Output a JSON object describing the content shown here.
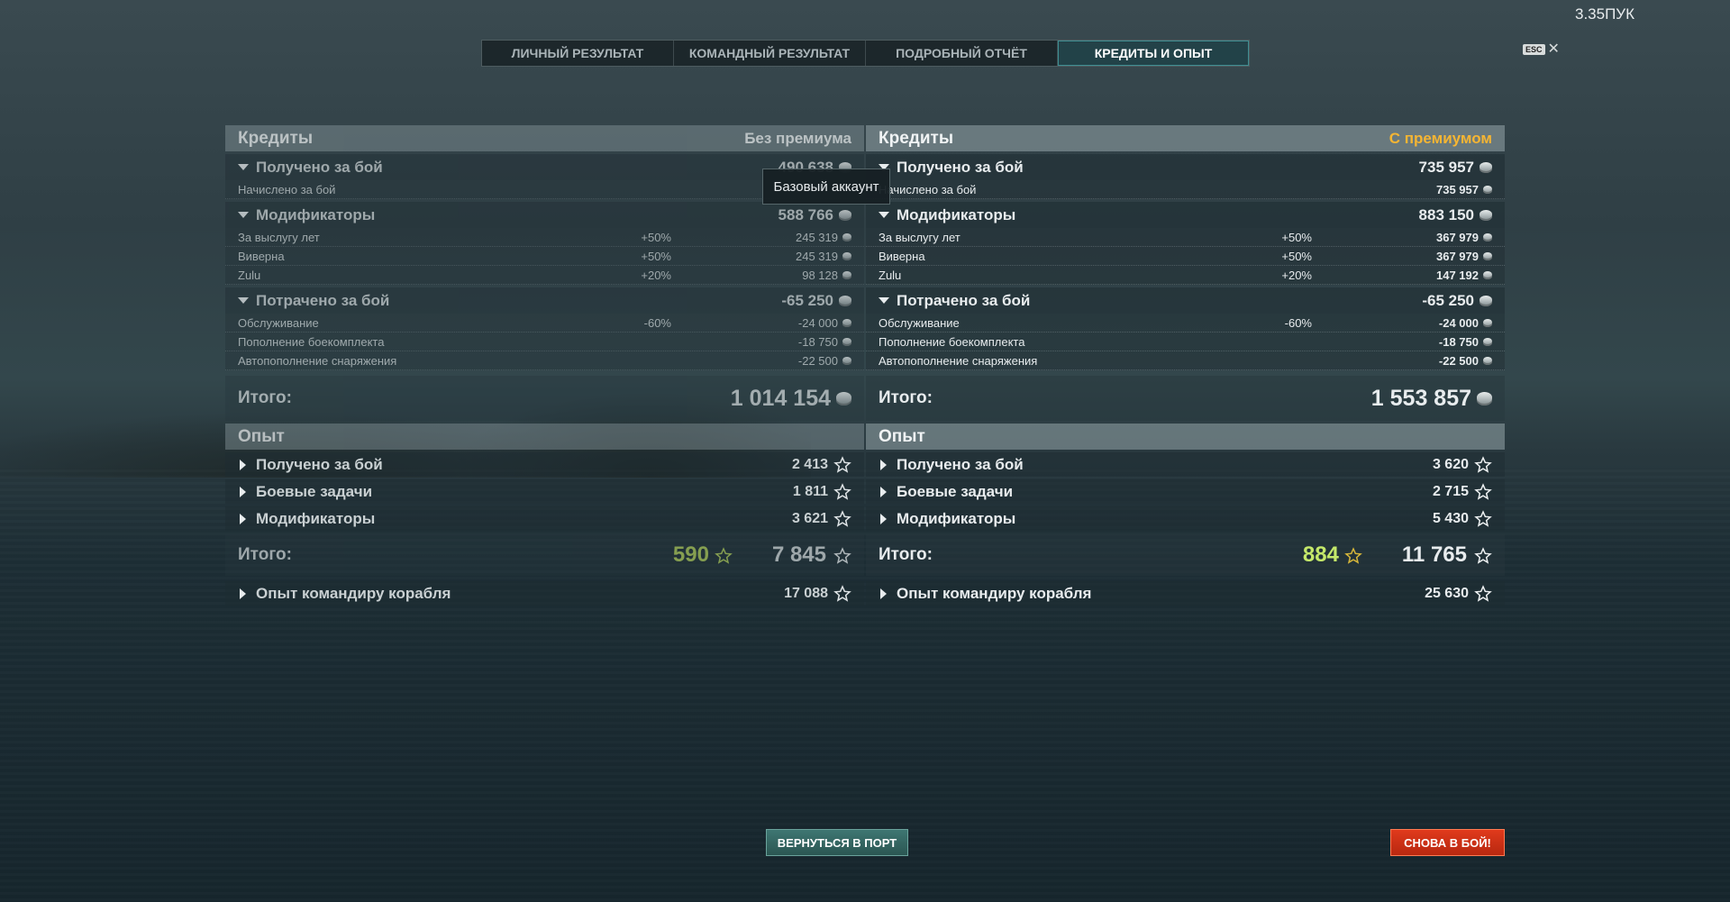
{
  "ping": "3.35ПУК",
  "tabs": [
    {
      "label": "ЛИЧНЫЙ РЕЗУЛЬТАТ",
      "active": false
    },
    {
      "label": "КОМАНДНЫЙ РЕЗУЛЬТАТ",
      "active": false
    },
    {
      "label": "ПОДРОБНЫЙ ОТЧЁТ",
      "active": false
    },
    {
      "label": "КРЕДИТЫ И ОПЫТ",
      "active": true
    }
  ],
  "esc": {
    "key": "ESC",
    "close": "✕"
  },
  "tooltip": "Базовый аккаунт",
  "left": {
    "credits_title": "Кредиты",
    "credits_sub": "Без премиума",
    "earned": {
      "label": "Получено за бой",
      "value": "490 638"
    },
    "earned_items": [
      {
        "label": "Начислено за бой",
        "pct": "",
        "value": ""
      }
    ],
    "modifiers": {
      "label": "Модификаторы",
      "value": "588 766"
    },
    "modifier_items": [
      {
        "label": "За выслугу лет",
        "pct": "+50%",
        "value": "245 319"
      },
      {
        "label": "Виверна",
        "pct": "+50%",
        "value": "245 319"
      },
      {
        "label": "Zulu",
        "pct": "+20%",
        "value": "98 128"
      }
    ],
    "spent": {
      "label": "Потрачено за бой",
      "value": "-65 250"
    },
    "spent_items": [
      {
        "label": "Обслуживание",
        "pct": "-60%",
        "value": "-24 000"
      },
      {
        "label": "Пополнение боекомплекта",
        "pct": "",
        "value": "-18 750"
      },
      {
        "label": "Автопополнение снаряжения",
        "pct": "",
        "value": "-22 500"
      }
    ],
    "total_label": "Итого:",
    "total_value": "1 014 154",
    "xp_title": "Опыт",
    "xp_rows": [
      {
        "label": "Получено за бой",
        "value": "2 413"
      },
      {
        "label": "Боевые задачи",
        "value": "1 811"
      },
      {
        "label": "Модификаторы",
        "value": "3 621"
      }
    ],
    "xp_total_label": "Итого:",
    "xp_free": "590",
    "xp_total": "7 845",
    "commander": {
      "label": "Опыт командиру корабля",
      "value": "17 088"
    }
  },
  "right": {
    "credits_title": "Кредиты",
    "credits_sub": "С премиумом",
    "earned": {
      "label": "Получено за бой",
      "value": "735 957"
    },
    "earned_items": [
      {
        "label": "Начислено за бой",
        "pct": "",
        "value": "735 957"
      }
    ],
    "modifiers": {
      "label": "Модификаторы",
      "value": "883 150"
    },
    "modifier_items": [
      {
        "label": "За выслугу лет",
        "pct": "+50%",
        "value": "367 979"
      },
      {
        "label": "Виверна",
        "pct": "+50%",
        "value": "367 979"
      },
      {
        "label": "Zulu",
        "pct": "+20%",
        "value": "147 192"
      }
    ],
    "spent": {
      "label": "Потрачено за бой",
      "value": "-65 250"
    },
    "spent_items": [
      {
        "label": "Обслуживание",
        "pct": "-60%",
        "value": "-24 000"
      },
      {
        "label": "Пополнение боекомплекта",
        "pct": "",
        "value": "-18 750"
      },
      {
        "label": "Автопополнение снаряжения",
        "pct": "",
        "value": "-22 500"
      }
    ],
    "total_label": "Итого:",
    "total_value": "1 553 857",
    "xp_title": "Опыт",
    "xp_rows": [
      {
        "label": "Получено за бой",
        "value": "3 620"
      },
      {
        "label": "Боевые задачи",
        "value": "2 715"
      },
      {
        "label": "Модификаторы",
        "value": "5 430"
      }
    ],
    "xp_total_label": "Итого:",
    "xp_free": "884",
    "xp_total": "11 765",
    "commander": {
      "label": "Опыт командиру корабля",
      "value": "25 630"
    }
  },
  "buttons": {
    "port": "ВЕРНУТЬСЯ В ПОРТ",
    "battle": "СНОВА В БОЙ!"
  },
  "colors": {
    "premium_accent": "#f5b533",
    "free_xp": "#c4e86a",
    "battle_button": "#d8361a",
    "port_button": "#357069"
  }
}
